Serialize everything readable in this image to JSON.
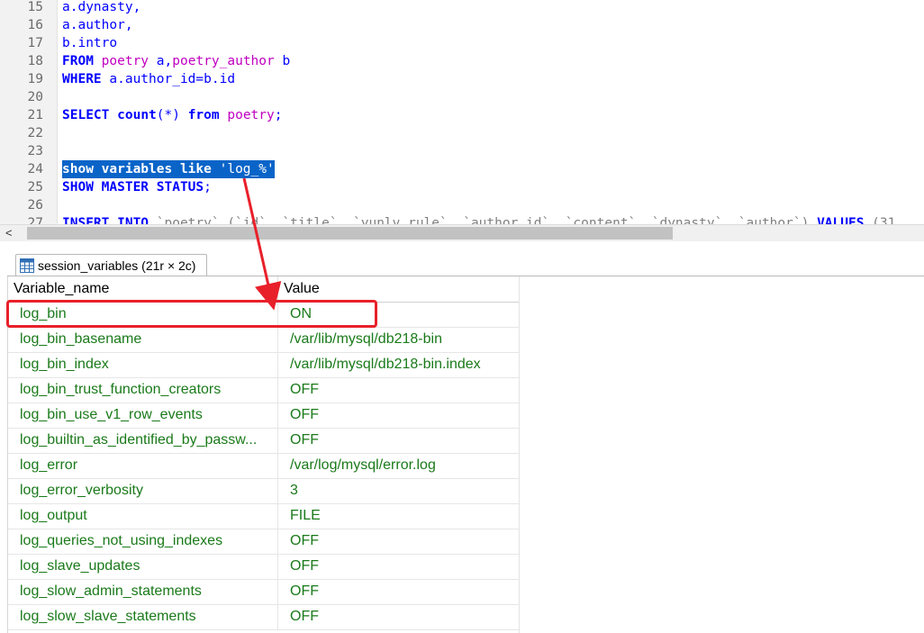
{
  "editor": {
    "lines": [
      {
        "n": "15",
        "tokens": [
          {
            "t": "a.dynasty,",
            "c": "id"
          }
        ]
      },
      {
        "n": "16",
        "tokens": [
          {
            "t": "a.author,",
            "c": "id"
          }
        ]
      },
      {
        "n": "17",
        "tokens": [
          {
            "t": "b.intro",
            "c": "id"
          }
        ]
      },
      {
        "n": "18",
        "tokens": [
          {
            "t": "FROM",
            "c": "kw"
          },
          {
            "t": " ",
            "c": ""
          },
          {
            "t": "poetry",
            "c": "tbl"
          },
          {
            "t": " a,",
            "c": "id"
          },
          {
            "t": "poetry_author",
            "c": "tbl"
          },
          {
            "t": " b",
            "c": "id"
          }
        ]
      },
      {
        "n": "19",
        "tokens": [
          {
            "t": "WHERE",
            "c": "kw"
          },
          {
            "t": " a.author_id=b.id",
            "c": "id"
          }
        ]
      },
      {
        "n": "20",
        "tokens": []
      },
      {
        "n": "21",
        "tokens": [
          {
            "t": "SELECT",
            "c": "kw"
          },
          {
            "t": " ",
            "c": ""
          },
          {
            "t": "count",
            "c": "kw"
          },
          {
            "t": "(*) ",
            "c": "op"
          },
          {
            "t": "from",
            "c": "kw"
          },
          {
            "t": " ",
            "c": ""
          },
          {
            "t": "poetry",
            "c": "tbl"
          },
          {
            "t": ";",
            "c": "op"
          }
        ]
      },
      {
        "n": "22",
        "tokens": []
      },
      {
        "n": "23",
        "tokens": []
      },
      {
        "n": "24",
        "selected": true,
        "tokens": [
          {
            "t": "show variables like",
            "c": "kw"
          },
          {
            "t": " ",
            "c": ""
          },
          {
            "t": "'log_%'",
            "c": "str"
          }
        ]
      },
      {
        "n": "25",
        "tokens": [
          {
            "t": "SHOW MASTER STATUS",
            "c": "kw"
          },
          {
            "t": ";",
            "c": "op"
          }
        ]
      },
      {
        "n": "26",
        "tokens": []
      },
      {
        "n": "27",
        "tokens": [
          {
            "t": "INSERT INTO",
            "c": "kw"
          },
          {
            "t": " `poetry` (`id`, `title`, `yunlv_rule`, `author_id`, `content`, `dynasty`, `author`) ",
            "c": "dim"
          },
          {
            "t": "VALUES",
            "c": "kw"
          },
          {
            "t": " (31",
            "c": "dim"
          }
        ]
      }
    ]
  },
  "scrollbar": {
    "left_arrow": "<"
  },
  "result_tab": {
    "label": "session_variables (21r × 2c)",
    "icon": "table-grid-icon"
  },
  "grid": {
    "columns": [
      "Variable_name",
      "Value"
    ],
    "rows": [
      [
        "log_bin",
        "ON"
      ],
      [
        "log_bin_basename",
        "/var/lib/mysql/db218-bin"
      ],
      [
        "log_bin_index",
        "/var/lib/mysql/db218-bin.index"
      ],
      [
        "log_bin_trust_function_creators",
        "OFF"
      ],
      [
        "log_bin_use_v1_row_events",
        "OFF"
      ],
      [
        "log_builtin_as_identified_by_passw...",
        "OFF"
      ],
      [
        "log_error",
        "/var/log/mysql/error.log"
      ],
      [
        "log_error_verbosity",
        "3"
      ],
      [
        "log_output",
        "FILE"
      ],
      [
        "log_queries_not_using_indexes",
        "OFF"
      ],
      [
        "log_slave_updates",
        "OFF"
      ],
      [
        "log_slow_admin_statements",
        "OFF"
      ],
      [
        "log_slow_slave_statements",
        "OFF"
      ]
    ]
  },
  "annotation": {
    "color": "#e8202a"
  },
  "colors": {
    "keyword": "#0000ff",
    "table": "#c000c0",
    "value_text": "#1a7a1a",
    "selection": "#0a64c8"
  }
}
